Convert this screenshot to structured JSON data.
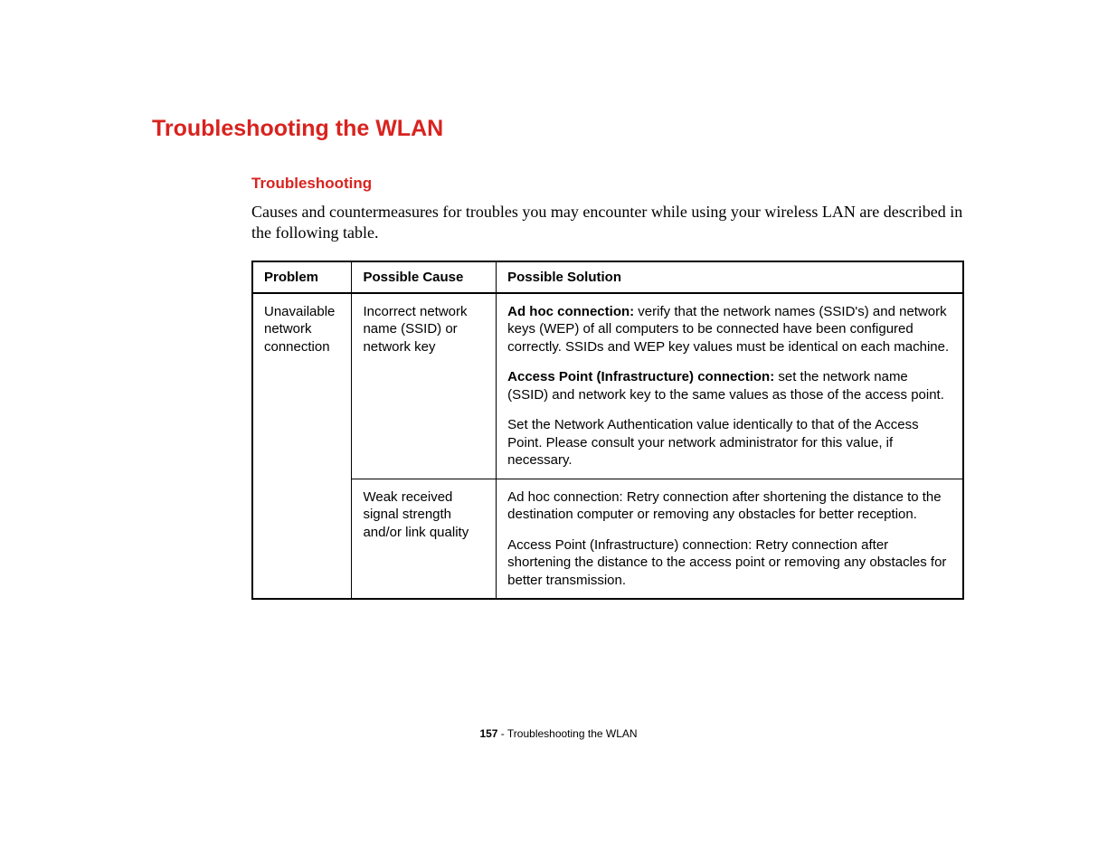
{
  "heading": "Troubleshooting the WLAN",
  "subheading": "Troubleshooting",
  "intro": "Causes and countermeasures for troubles you may encounter while using your wireless LAN are described in the following table.",
  "table": {
    "headers": {
      "problem": "Problem",
      "cause": "Possible Cause",
      "solution": "Possible Solution"
    },
    "rows": {
      "problem1": "Unavailable network connection",
      "cause1": "Incorrect network name (SSID) or network key",
      "solution1a_label": "Ad hoc connection:",
      "solution1a_text": " verify that the network names (SSID's) and network keys (WEP) of all computers to be connected have been configured correctly. SSIDs and WEP key values must be identical on each machine.",
      "solution1b_label": "Access Point (Infrastructure) connection:",
      "solution1b_text": " set the network name (SSID) and network key to the same values as those of the access point.",
      "solution1c": "Set the Network Authentication value identically to that of the Access Point. Please consult your network administrator for this value, if necessary.",
      "cause2": "Weak received signal strength and/or link quality",
      "solution2a": "Ad hoc connection: Retry connection after shortening the distance to the destination computer or removing any obstacles for better reception.",
      "solution2b": "Access Point (Infrastructure) connection: Retry connection after shortening the distance to the access point or removing any obstacles for better transmission."
    }
  },
  "footer": {
    "page": "157",
    "separator": " - ",
    "title": "Troubleshooting the WLAN"
  }
}
